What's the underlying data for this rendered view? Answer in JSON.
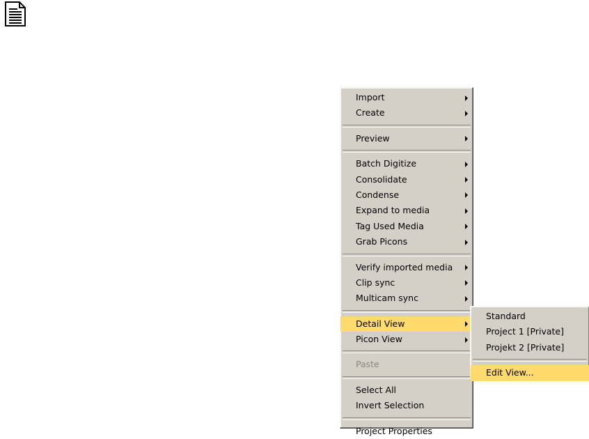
{
  "menu": {
    "groups": [
      [
        {
          "label": "Import",
          "submenu": true
        },
        {
          "label": "Create",
          "submenu": true
        }
      ],
      [
        {
          "label": "Preview",
          "submenu": true
        }
      ],
      [
        {
          "label": "Batch Digitize",
          "submenu": true
        },
        {
          "label": "Consolidate",
          "submenu": true
        },
        {
          "label": "Condense",
          "submenu": true
        },
        {
          "label": "Expand to media",
          "submenu": true
        },
        {
          "label": "Tag Used Media",
          "submenu": true
        },
        {
          "label": "Grab Picons",
          "submenu": true
        }
      ],
      [
        {
          "label": "Verify imported media",
          "submenu": true
        },
        {
          "label": "Clip sync",
          "submenu": true
        },
        {
          "label": "Multicam sync",
          "submenu": true
        }
      ],
      [
        {
          "label": "Detail View",
          "submenu": true,
          "highlighted": true
        },
        {
          "label": "Picon View",
          "submenu": true
        }
      ],
      [
        {
          "label": "Paste",
          "submenu": false,
          "disabled": true
        }
      ],
      [
        {
          "label": "Select All",
          "submenu": false
        },
        {
          "label": "Invert Selection",
          "submenu": false
        }
      ],
      [
        {
          "label": "Project Properties",
          "submenu": false
        }
      ]
    ]
  },
  "submenu": {
    "groups": [
      [
        {
          "label": "Standard"
        },
        {
          "label": "Project 1 [Private]"
        },
        {
          "label": "Projekt 2 [Private]"
        }
      ],
      [
        {
          "label": "Edit View...",
          "highlighted": true
        }
      ]
    ]
  },
  "colors": {
    "menu_background": "#d4d0c8",
    "highlight": "#ffdb6e",
    "disabled_text": "#8a8680"
  },
  "icons": {
    "top_left": "document-note-icon"
  }
}
